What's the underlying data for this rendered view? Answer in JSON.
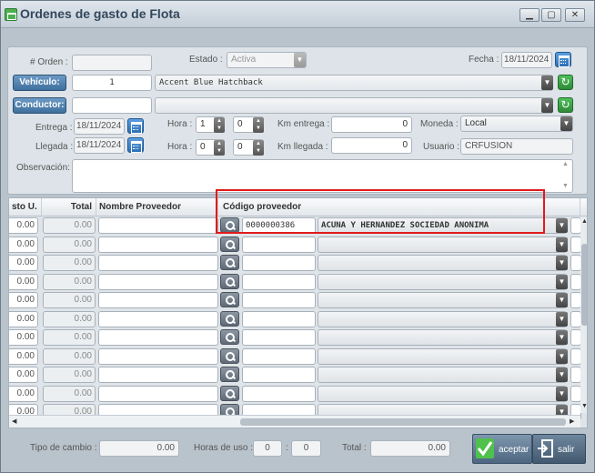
{
  "window": {
    "title": "Ordenes de gasto de Flota",
    "minimize": "▁",
    "maximize": "▢",
    "close": "✕"
  },
  "form": {
    "orden_label": "# Orden :",
    "orden_value": "",
    "estado_label": "Estado :",
    "estado_value": "Activa",
    "fecha_label": "Fecha :",
    "fecha_value": "18/11/2024",
    "vehiculo_label": "Vehículo:",
    "vehiculo_id": "1",
    "vehiculo_name": "Accent Blue Hatchback",
    "conductor_label": "Conductor:",
    "conductor_id": "",
    "conductor_name": "",
    "entrega_label": "Entrega :",
    "entrega_value": "18/11/2024",
    "llegada_label": "Llegada :",
    "llegada_value": "18/11/2024",
    "hora_label": "Hora :",
    "hora_entrega_h": "1",
    "hora_entrega_m": "0",
    "hora_llegada_h": "0",
    "hora_llegada_m": "0",
    "km_entrega_label": "Km entrega :",
    "km_entrega_value": "0",
    "km_llegada_label": "Km llegada :",
    "km_llegada_value": "0",
    "moneda_label": "Moneda :",
    "moneda_value": "Local",
    "usuario_label": "Usuario :",
    "usuario_value": "CRFUSION",
    "observacion_label": "Observación:",
    "observacion_value": ""
  },
  "grid": {
    "headers": [
      "sto U.",
      "Total",
      "Nombre Proveedor",
      "Código proveedor"
    ],
    "rows": [
      {
        "costo": "0.00",
        "total": "0.00",
        "nombre": "",
        "codigo": "0000000386",
        "proveedor": "ACUNA Y HERNANDEZ SOCIEDAD ANONIMA"
      },
      {
        "costo": "0.00",
        "total": "0.00",
        "nombre": "",
        "codigo": "",
        "proveedor": ""
      },
      {
        "costo": "0.00",
        "total": "0.00",
        "nombre": "",
        "codigo": "",
        "proveedor": ""
      },
      {
        "costo": "0.00",
        "total": "0.00",
        "nombre": "",
        "codigo": "",
        "proveedor": ""
      },
      {
        "costo": "0.00",
        "total": "0.00",
        "nombre": "",
        "codigo": "",
        "proveedor": ""
      },
      {
        "costo": "0.00",
        "total": "0.00",
        "nombre": "",
        "codigo": "",
        "proveedor": ""
      },
      {
        "costo": "0.00",
        "total": "0.00",
        "nombre": "",
        "codigo": "",
        "proveedor": ""
      },
      {
        "costo": "0.00",
        "total": "0.00",
        "nombre": "",
        "codigo": "",
        "proveedor": ""
      },
      {
        "costo": "0.00",
        "total": "0.00",
        "nombre": "",
        "codigo": "",
        "proveedor": ""
      },
      {
        "costo": "0.00",
        "total": "0.00",
        "nombre": "",
        "codigo": "",
        "proveedor": ""
      },
      {
        "costo": "0.00",
        "total": "0.00",
        "nombre": "",
        "codigo": "",
        "proveedor": ""
      }
    ]
  },
  "footer": {
    "tipo_cambio_label": "Tipo de cambio :",
    "tipo_cambio_value": "0.00",
    "horas_uso_label": "Horas de uso :",
    "horas_uso_h": "0",
    "horas_uso_m": "0",
    "total_label": "Total :",
    "total_value": "0.00",
    "aceptar_label": "aceptar",
    "salir_label": "salir"
  },
  "colors": {
    "highlight": "#e01b1b",
    "accent": "#3f6f9d"
  }
}
